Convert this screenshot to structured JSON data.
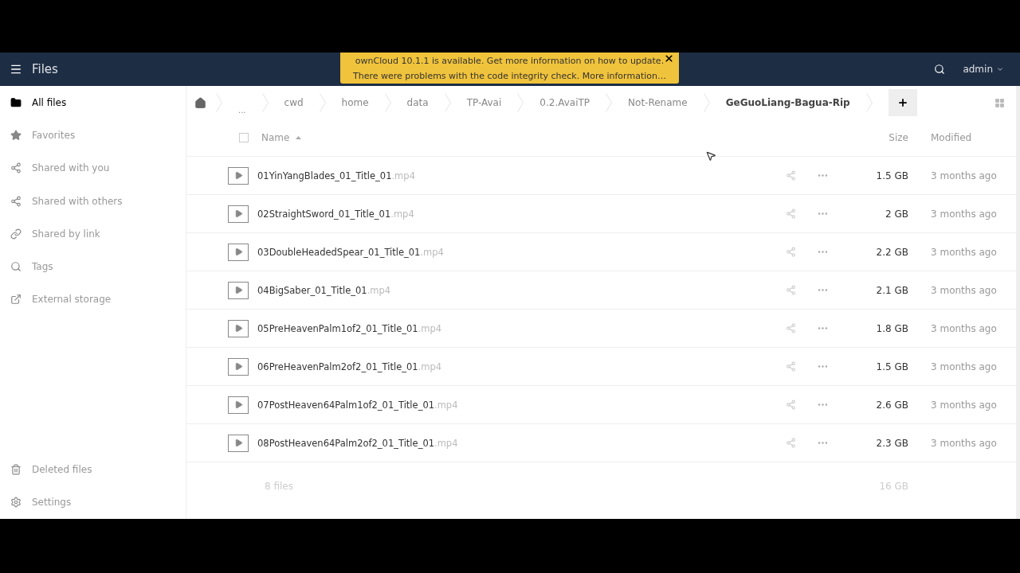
{
  "header": {
    "app_title": "Files",
    "user": "admin"
  },
  "notification": {
    "lines": [
      "ownCloud 10.1.1 is available. Get more information on how to update.",
      "There were problems with the code integrity check. More information…"
    ]
  },
  "sidebar": {
    "items": [
      {
        "label": "All files",
        "selected": true
      },
      {
        "label": "Favorites",
        "selected": false
      },
      {
        "label": "Shared with you",
        "selected": false
      },
      {
        "label": "Shared with others",
        "selected": false
      },
      {
        "label": "Shared by link",
        "selected": false
      },
      {
        "label": "Tags",
        "selected": false
      },
      {
        "label": "External storage",
        "selected": false
      }
    ],
    "bottom_items": [
      {
        "label": "Deleted files"
      },
      {
        "label": "Settings"
      }
    ]
  },
  "breadcrumbs": [
    "...",
    "cwd",
    "home",
    "data",
    "TP-Avai",
    "0.2.AvaiTP",
    "Not-Rename",
    "GeGuoLiang-Bagua-Rip"
  ],
  "table": {
    "select_all_checked": false,
    "columns": {
      "name": "Name",
      "size": "Size",
      "modified": "Modified"
    },
    "rows": [
      {
        "name": "01YinYangBlades_01_Title_01",
        "ext": ".mp4",
        "size": "1.5 GB",
        "modified": "3 months ago"
      },
      {
        "name": "02StraightSword_01_Title_01",
        "ext": ".mp4",
        "size": "2 GB",
        "modified": "3 months ago"
      },
      {
        "name": "03DoubleHeadedSpear_01_Title_01",
        "ext": ".mp4",
        "size": "2.2 GB",
        "modified": "3 months ago"
      },
      {
        "name": "04BigSaber_01_Title_01",
        "ext": ".mp4",
        "size": "2.1 GB",
        "modified": "3 months ago"
      },
      {
        "name": "05PreHeavenPalm1of2_01_Title_01",
        "ext": ".mp4",
        "size": "1.8 GB",
        "modified": "3 months ago"
      },
      {
        "name": "06PreHeavenPalm2of2_01_Title_01",
        "ext": ".mp4",
        "size": "1.5 GB",
        "modified": "3 months ago"
      },
      {
        "name": "07PostHeaven64Palm1of2_01_Title_01",
        "ext": ".mp4",
        "size": "2.6 GB",
        "modified": "3 months ago"
      },
      {
        "name": "08PostHeaven64Palm2of2_01_Title_01",
        "ext": ".mp4",
        "size": "2.3 GB",
        "modified": "3 months ago"
      }
    ],
    "summary": {
      "count": "8 files",
      "size": "16 GB"
    }
  }
}
